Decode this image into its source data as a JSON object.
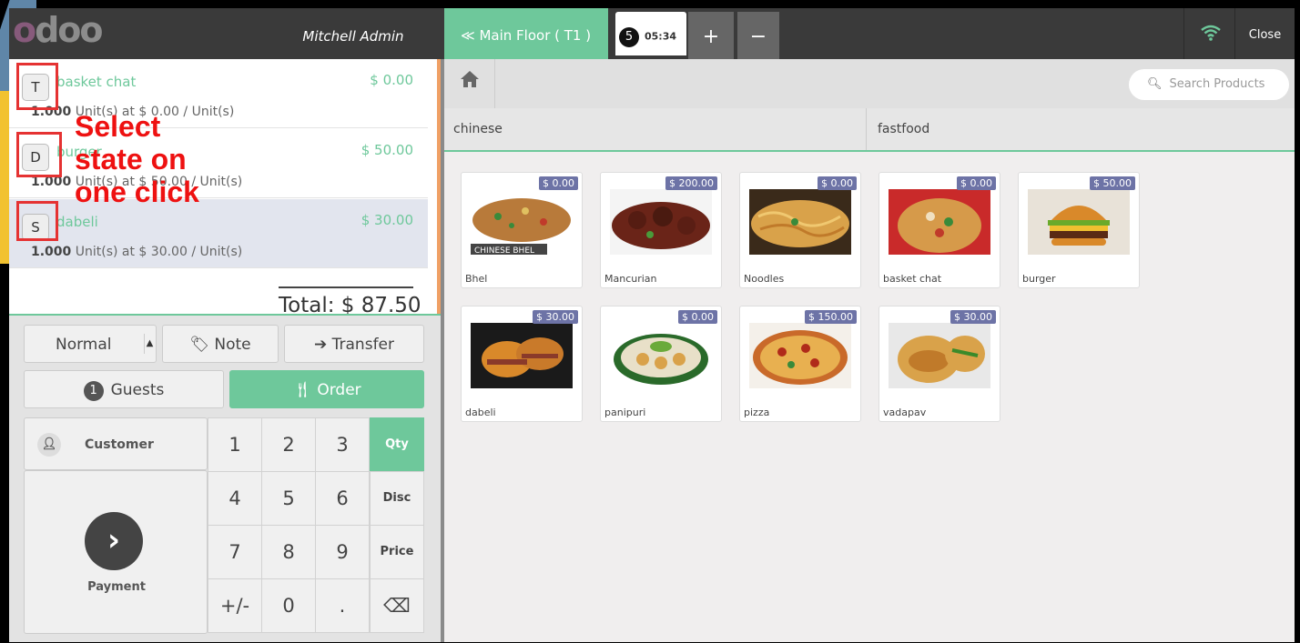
{
  "header": {
    "user": "Mitchell Admin",
    "floor_label": "≪ Main Floor ( T1 )",
    "order_number": "5",
    "order_time": "05:34",
    "plus_label": "+",
    "minus_label": "−",
    "close_label": "Close"
  },
  "logo": {
    "o1": "o",
    "rest": "doo"
  },
  "orderlines": [
    {
      "state": "T",
      "name": "basket chat",
      "price": "$ 0.00",
      "qty": "1.000",
      "unit_text": " Unit(s) at $ 0.00 / Unit(s)"
    },
    {
      "state": "D",
      "name": "burger",
      "price": "$ 50.00",
      "qty": "1.000",
      "unit_text": " Unit(s) at $ 50.00 / Unit(s)"
    },
    {
      "state": "S",
      "name": "dabeli",
      "price": "$ 30.00",
      "qty": "1.000",
      "unit_text": " Unit(s) at $ 30.00 / Unit(s)"
    }
  ],
  "annotation": {
    "line1": "Select",
    "line2": "state on",
    "line3": "one click"
  },
  "total": "Total: $ 87.50",
  "actions": {
    "normal": "Normal",
    "note": "Note",
    "transfer": "Transfer",
    "guests_count": "1",
    "guests": "Guests",
    "order": "Order",
    "customer": "Customer",
    "payment": "Payment"
  },
  "numpad": {
    "keys": [
      "1",
      "2",
      "3",
      "Qty",
      "4",
      "5",
      "6",
      "Disc",
      "7",
      "8",
      "9",
      "Price",
      "+/-",
      "0",
      ".",
      "⌫"
    ]
  },
  "search": {
    "placeholder": "Search Products"
  },
  "categories": [
    "chinese",
    "fastfood"
  ],
  "products": [
    {
      "name": "Bhel",
      "price": "$ 0.00"
    },
    {
      "name": "Mancurian",
      "price": "$ 200.00"
    },
    {
      "name": "Noodles",
      "price": "$ 0.00"
    },
    {
      "name": "basket chat",
      "price": "$ 0.00"
    },
    {
      "name": "burger",
      "price": "$ 50.00"
    },
    {
      "name": "dabeli",
      "price": "$ 30.00"
    },
    {
      "name": "panipuri",
      "price": "$ 0.00"
    },
    {
      "name": "pizza",
      "price": "$ 150.00"
    },
    {
      "name": "vadapav",
      "price": "$ 30.00"
    }
  ],
  "product_image_labels": {
    "bhel": "CHINESE BHEL"
  },
  "colors": {
    "accent": "#6ec89b",
    "price_badge": "#6d73a6",
    "annotation_red": "#e53232",
    "topbar": "#3a3a3a"
  }
}
